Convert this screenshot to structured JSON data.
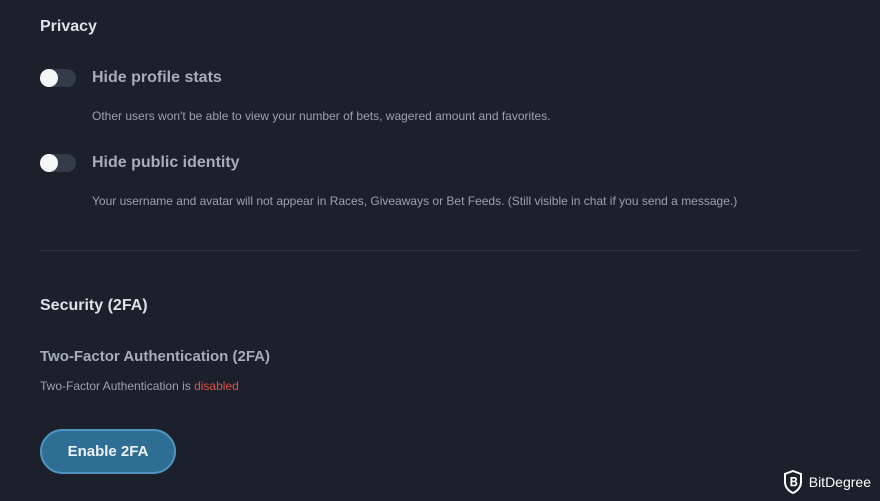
{
  "privacy": {
    "title": "Privacy",
    "options": [
      {
        "label": "Hide profile stats",
        "description": "Other users won't be able to view your number of bets, wagered amount and favorites.",
        "enabled": false
      },
      {
        "label": "Hide public identity",
        "description": "Your username and avatar will not appear in Races, Giveaways or Bet Feeds. (Still visible in chat if you send a message.)",
        "enabled": false
      }
    ]
  },
  "security": {
    "title": "Security (2FA)",
    "twofa_heading": "Two-Factor Authentication (2FA)",
    "status_prefix": "Two-Factor Authentication is ",
    "status_value": "disabled",
    "enable_button": "Enable 2FA"
  },
  "watermark": {
    "text": "BitDegree",
    "icon": "bitdegree-shield-logo"
  },
  "colors": {
    "background": "#1b202b",
    "status_disabled": "#d9544f",
    "button_fill": "#2e6d94",
    "button_border": "#4f94be"
  }
}
